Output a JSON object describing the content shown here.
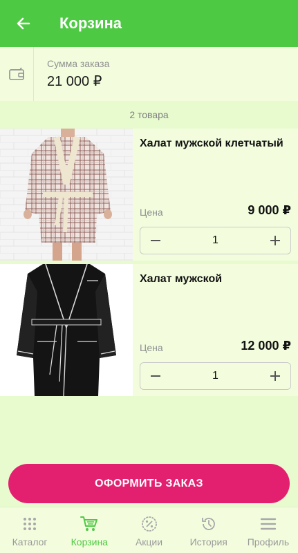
{
  "header": {
    "title": "Корзина"
  },
  "summary": {
    "label": "Сумма заказа",
    "value": "21 000 ₽"
  },
  "cart": {
    "count_label": "2 товара",
    "items": [
      {
        "name": "Халат мужской клетчатый",
        "price_label": "Цена",
        "price": "9 000 ₽",
        "quantity": "1"
      },
      {
        "name": "Халат мужской",
        "price_label": "Цена",
        "price": "12 000 ₽",
        "quantity": "1"
      }
    ]
  },
  "order_button": {
    "label": "ОФОРМИТЬ ЗАКАЗ"
  },
  "nav": {
    "items": [
      {
        "label": "Каталог",
        "icon": "grid-dots-icon"
      },
      {
        "label": "Корзина",
        "icon": "cart-icon",
        "active": true
      },
      {
        "label": "Акции",
        "icon": "percent-badge-icon"
      },
      {
        "label": "История",
        "icon": "history-icon"
      },
      {
        "label": "Профиль",
        "icon": "menu-icon"
      }
    ]
  },
  "colors": {
    "primary_green": "#4ec943",
    "accent_pink": "#e3206f",
    "background": "#e8fbcf",
    "card": "#f3fdde"
  }
}
